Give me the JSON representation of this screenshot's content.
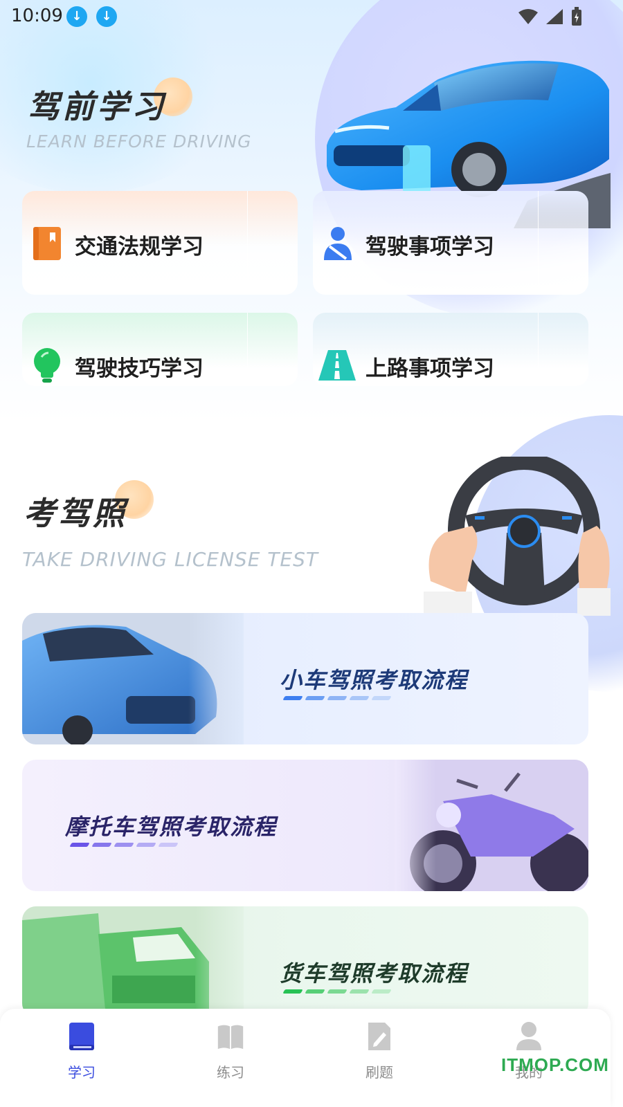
{
  "status_bar": {
    "time": "10:09",
    "icons": [
      "download-icon",
      "download-icon",
      "wifi-icon",
      "signal-icon",
      "battery-icon"
    ]
  },
  "learn_section": {
    "title": "驾前学习",
    "subtitle": "LEARN BEFORE DRIVING",
    "cards": [
      {
        "label": "交通法规学习",
        "icon": "book-icon",
        "color": "#f2852f"
      },
      {
        "label": "驾驶事项学习",
        "icon": "seatbelt-person-icon",
        "color": "#3b7cf0"
      },
      {
        "label": "驾驶技巧学习",
        "icon": "lightbulb-icon",
        "color": "#22c55e"
      },
      {
        "label": "上路事项学习",
        "icon": "road-icon",
        "color": "#25c7b7"
      }
    ]
  },
  "exam_section": {
    "title": "考驾照",
    "subtitle": "TAKE DRIVING LICENSE TEST",
    "banners": [
      {
        "label": "小车驾照考取流程",
        "color": "#1d3a78",
        "accent": "#3d7ef0"
      },
      {
        "label": "摩托车驾照考取流程",
        "color": "#2a2468",
        "accent": "#6a54e8"
      },
      {
        "label": "货车驾照考取流程",
        "color": "#1e3b2a",
        "accent": "#27c255"
      }
    ]
  },
  "bottom_nav": [
    {
      "label": "学习",
      "icon": "book-icon",
      "active": true
    },
    {
      "label": "练习",
      "icon": "open-book-icon",
      "active": false
    },
    {
      "label": "刷题",
      "icon": "document-edit-icon",
      "active": false
    },
    {
      "label": "我的",
      "icon": "person-icon",
      "active": false
    }
  ],
  "watermark": "ITMOP.COM",
  "colors": {
    "active": "#3a4cdf",
    "inactive": "#8c8c8c"
  }
}
